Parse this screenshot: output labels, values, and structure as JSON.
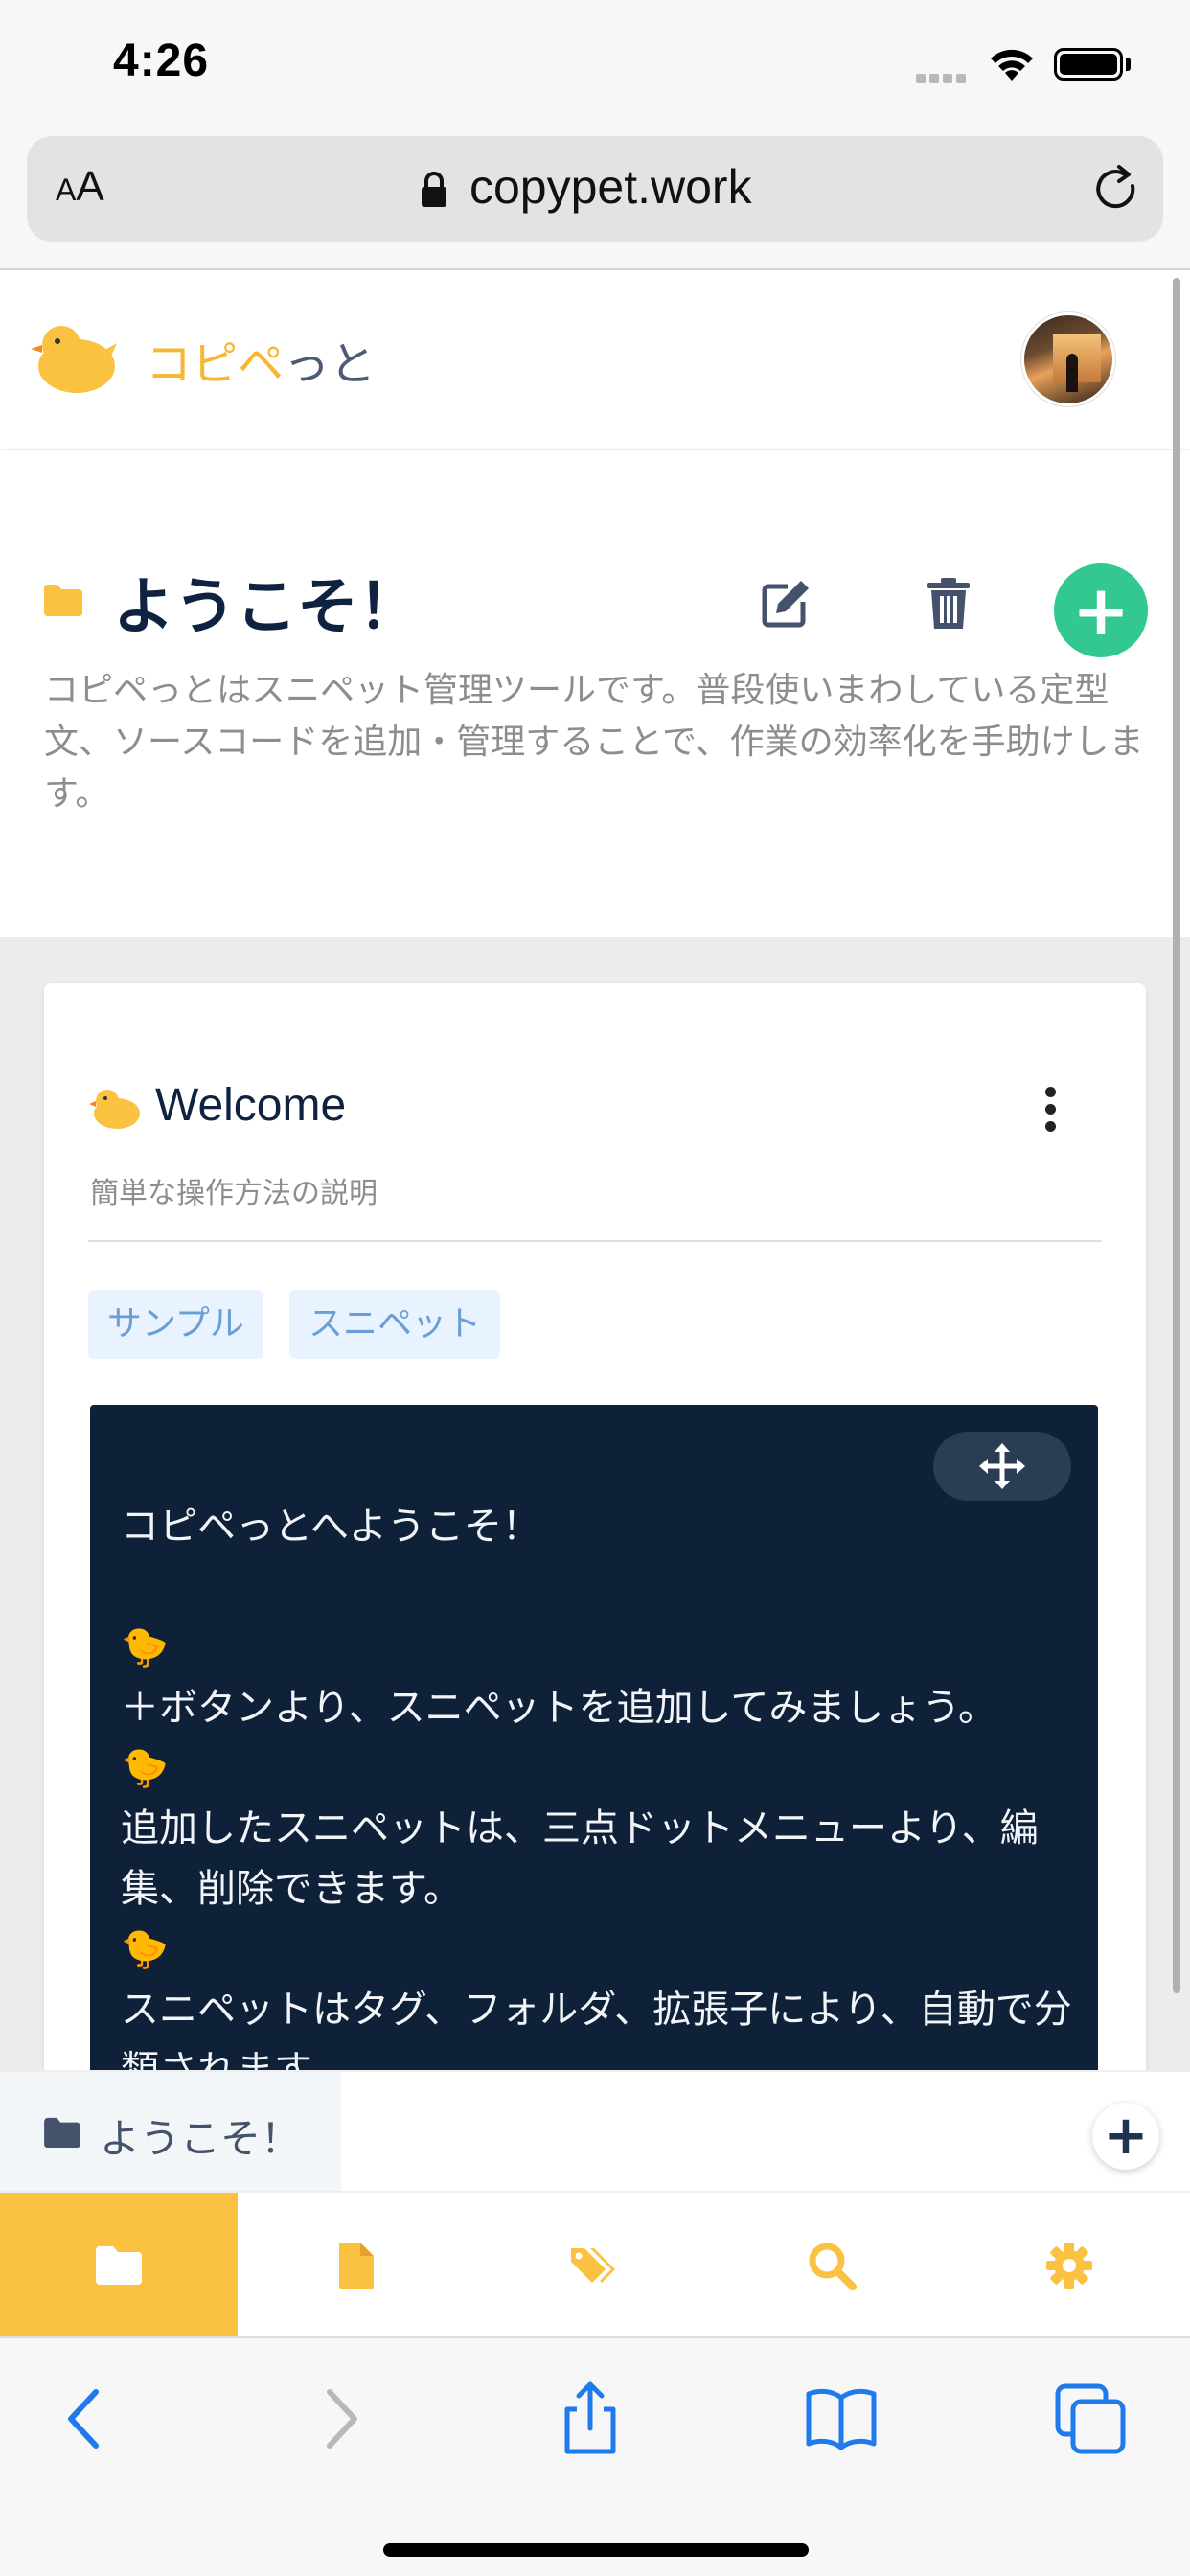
{
  "status_bar": {
    "time": "4:26"
  },
  "browser": {
    "aa_label_small": "A",
    "aa_label_large": "A",
    "url": "copypet.work"
  },
  "header": {
    "brand_accent": "コピペ",
    "brand_rest": "っと"
  },
  "folder": {
    "title": "ようこそ！",
    "description": "コピペっとはスニペット管理ツールです。普段使いまわしている定型文、ソースコードを追加・管理することで、作業の効率化を手助けします。"
  },
  "snippet": {
    "title": "Welcome",
    "subtitle": "簡単な操作方法の説明",
    "tags": [
      "サンプル",
      "スニペット"
    ],
    "code": "コピペっとへようこそ！\n\n🐤\n＋ボタンより、スニペットを追加してみましょう。\n🐤\n追加したスニペットは、三点ドットメニューより、編集、削除できます。\n🐤\nスニペットはタグ、フォルダ、拡張子により、自動で分類されます。"
  },
  "folder_bar": {
    "current_folder": "ようこそ！"
  },
  "tabs": [
    {
      "name": "folders",
      "icon": "folder-icon",
      "active": true
    },
    {
      "name": "files",
      "icon": "file-icon",
      "active": false
    },
    {
      "name": "tags",
      "icon": "tags-icon",
      "active": false
    },
    {
      "name": "search",
      "icon": "search-icon",
      "active": false
    },
    {
      "name": "settings",
      "icon": "gear-icon",
      "active": false
    }
  ],
  "colors": {
    "brand_yellow": "#fbc140",
    "add_green": "#33c890",
    "code_bg": "#0e2139",
    "ios_blue": "#1f7aec"
  }
}
